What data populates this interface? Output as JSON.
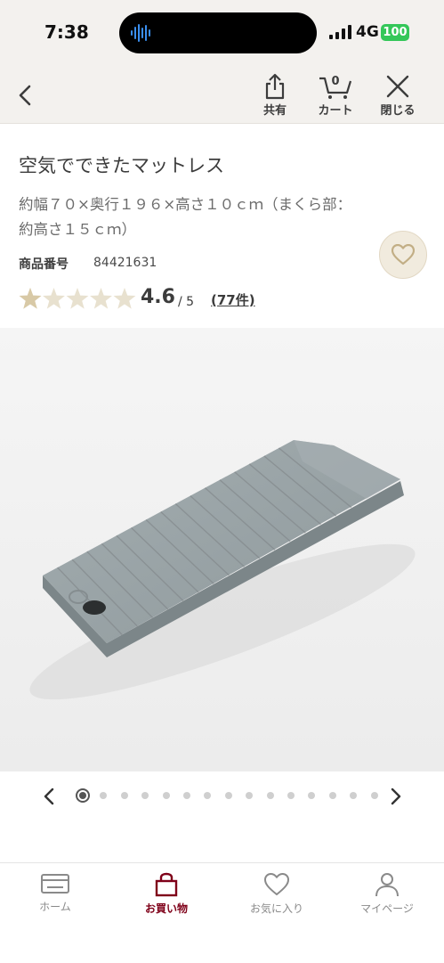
{
  "status_bar": {
    "time": "7:38",
    "network": "4G",
    "battery": "100",
    "battery_color": "#34c759"
  },
  "header": {
    "share_label": "共有",
    "cart_label": "カート",
    "cart_count": "0",
    "close_label": "閉じる"
  },
  "product": {
    "title": "空気でできたマットレス",
    "spec": "約幅７０×奥行１９６×高さ１０ｃｍ（まくら部：約高さ１５ｃｍ）",
    "code_label": "商品番号",
    "code_value": "84421631",
    "rating": "4.6",
    "rating_max": "/ 5",
    "rating_value": 4.6,
    "reviews": "(77件)",
    "star_color": "#d8c9a6"
  },
  "gallery": {
    "image_count": 15,
    "current_index": 0,
    "image_subject": "gray-air-mattress"
  },
  "tabbar": {
    "active_color": "#7f0019",
    "tabs": [
      {
        "label": "ホーム",
        "icon": "home-card-icon"
      },
      {
        "label": "お買い物",
        "icon": "shopping-bag-icon"
      },
      {
        "label": "お気に入り",
        "icon": "heart-icon"
      },
      {
        "label": "マイページ",
        "icon": "person-icon"
      }
    ]
  }
}
